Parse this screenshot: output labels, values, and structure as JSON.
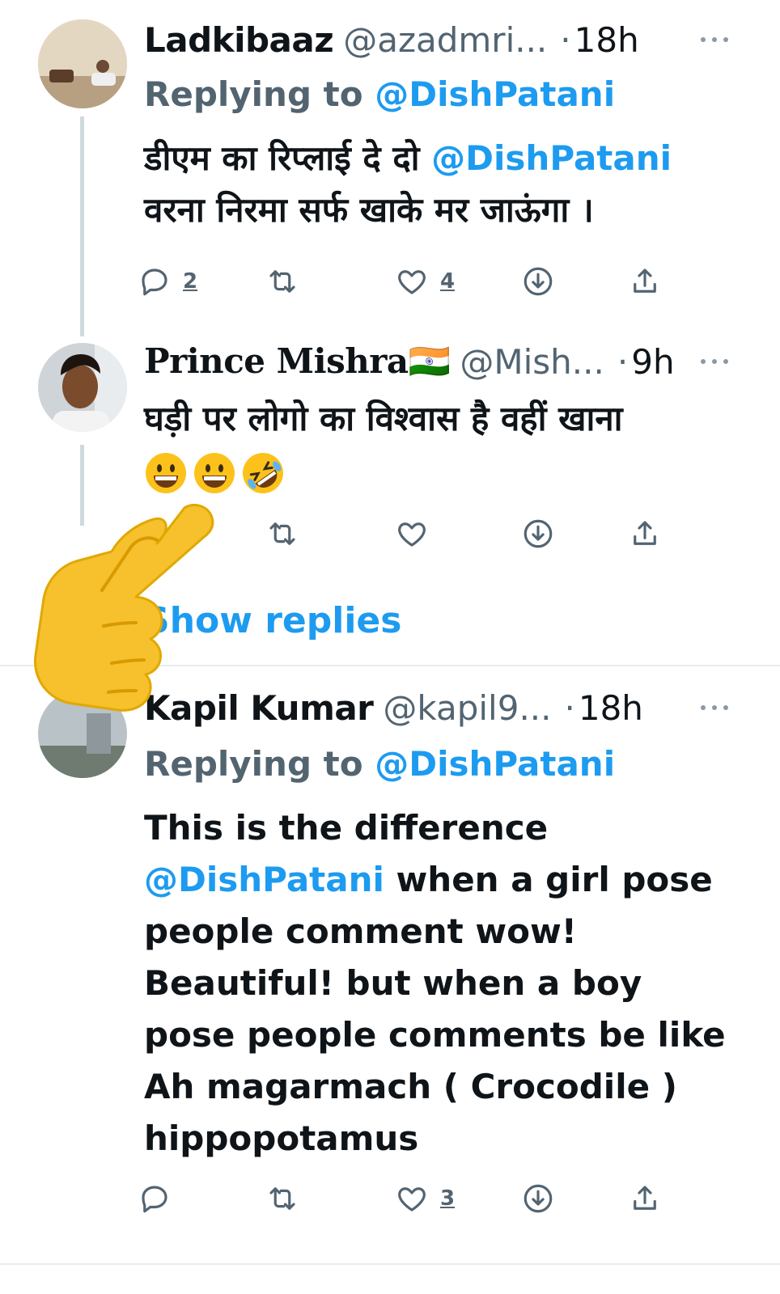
{
  "tweets": [
    {
      "name": "Ladkibaaz",
      "handle": "@azadmri...",
      "time": "18h",
      "replying_prefix": "Replying to",
      "replying_to": "@DishPatani",
      "text_line1_prefix": "डीएम का रिप्लाई दे दो",
      "text_line1_mention": "@DishPatani",
      "text_line2": "वरना निरमा सर्फ खाके मर जाऊंगा ।",
      "reply_count": "2",
      "like_count": "4"
    },
    {
      "name": "Prince Mishra🇮🇳",
      "handle": "@Mish...",
      "time": "9h",
      "text_line1": "घड़ी पर लोगो का विश्वास है वहीं खाना",
      "emoji": [
        "grinning-face",
        "grinning-face",
        "rolling-on-floor-laughing"
      ]
    },
    {
      "name": "Kapil Kumar",
      "handle": "@kapil9...",
      "time": "18h",
      "replying_prefix": "Replying to",
      "replying_to": "@DishPatani",
      "lines": [
        "This is the difference",
        "when a girl pose",
        "people comment wow!",
        "Beautiful! but when a boy",
        "pose people comments be like",
        "Ah magarmach ( Crocodile )",
        "hippopotamus"
      ],
      "line2_mention": "@DishPatani",
      "like_count": "3"
    }
  ],
  "show_replies_label": "Show replies",
  "dot_separator": "·",
  "colors": {
    "accent": "#1d9bf0",
    "secondary_text": "#536471",
    "thread_line": "#cfd9de",
    "hand_emoji": "#f6c12d"
  },
  "icons": [
    "reply-icon",
    "retweet-icon",
    "like-icon",
    "download-icon",
    "share-icon",
    "more-icon",
    "pointing-hand-emoji"
  ]
}
